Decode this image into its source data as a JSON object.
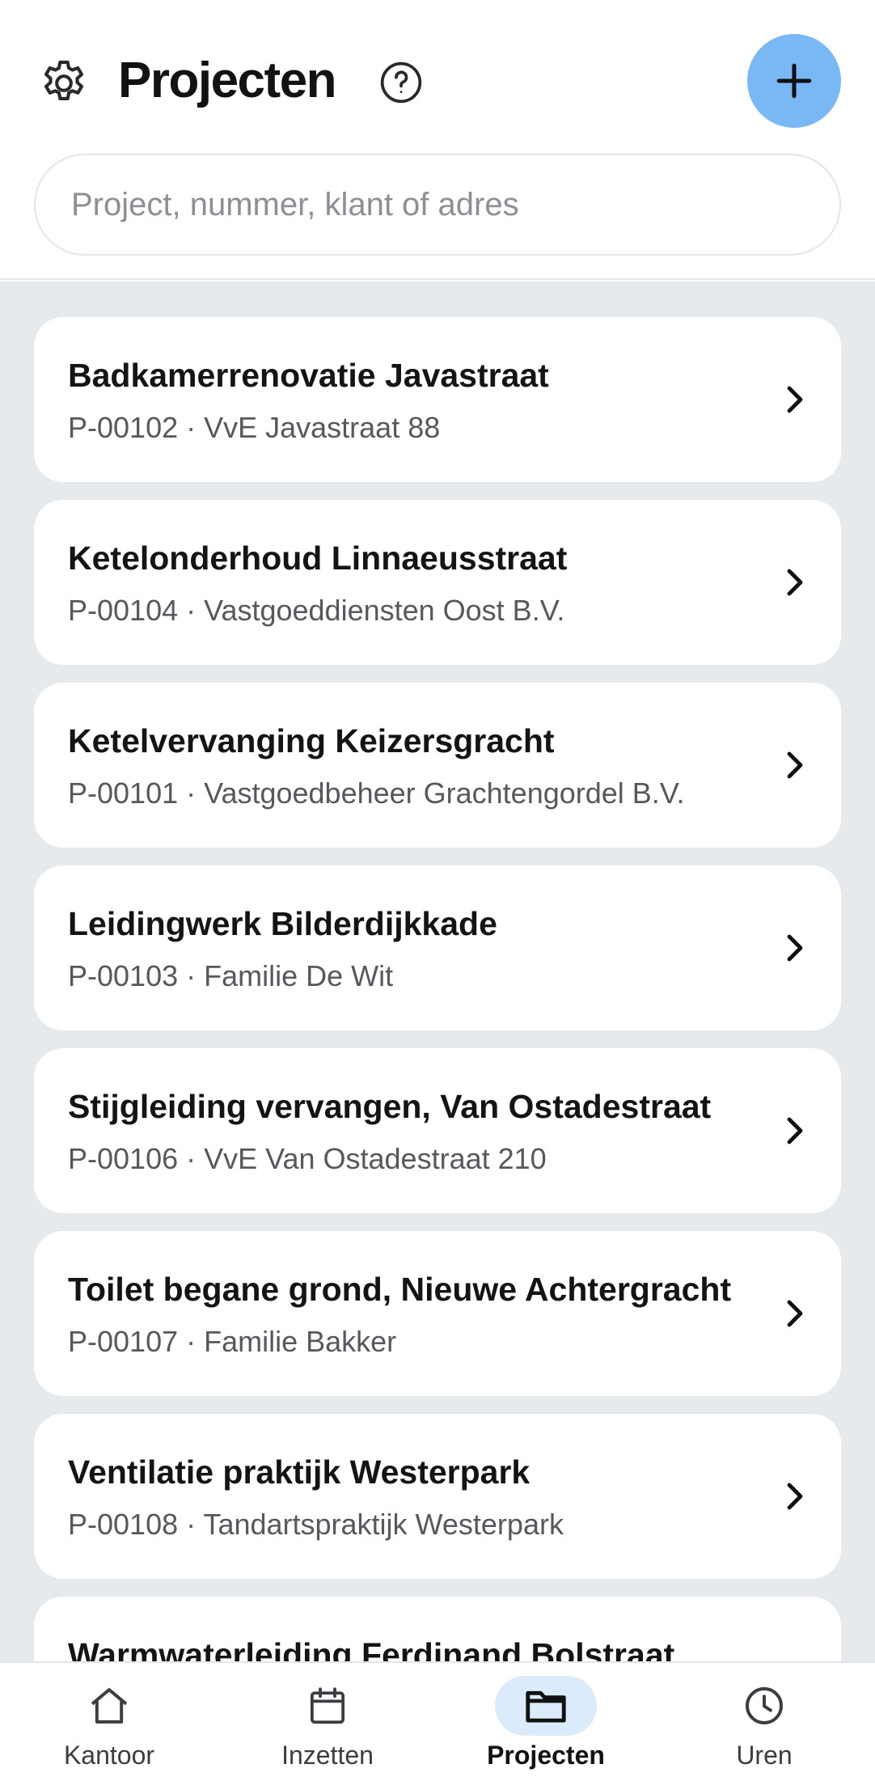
{
  "header": {
    "title": "Projecten",
    "settings_icon": "gear-icon",
    "help_icon": "question-icon",
    "add_icon": "plus-icon",
    "accent_color": "#7ab7f5"
  },
  "search": {
    "placeholder": "Project, nummer, klant of adres",
    "value": ""
  },
  "projects": [
    {
      "title": "Badkamerrenovatie Javastraat",
      "subtitle": "P-00102 · VvE Javastraat 88"
    },
    {
      "title": "Ketelonderhoud Linnaeusstraat",
      "subtitle": "P-00104 · Vastgoeddiensten Oost B.V."
    },
    {
      "title": "Ketelvervanging Keizersgracht",
      "subtitle": "P-00101 · Vastgoedbeheer Grachtengordel B.V."
    },
    {
      "title": "Leidingwerk Bilderdijkkade",
      "subtitle": "P-00103 · Familie De Wit"
    },
    {
      "title": "Stijgleiding vervangen, Van Ostadestraat",
      "subtitle": "P-00106 · VvE Van Ostadestraat 210"
    },
    {
      "title": "Toilet begane grond, Nieuwe Achtergracht",
      "subtitle": "P-00107 · Familie Bakker"
    },
    {
      "title": "Ventilatie praktijk Westerpark",
      "subtitle": "P-00108 · Tandartspraktijk Westerpark"
    },
    {
      "title": "Warmwaterleiding Ferdinand Bolstraat",
      "subtitle": ""
    }
  ],
  "tabbar": {
    "tabs": [
      {
        "label": "Kantoor",
        "icon": "home-icon",
        "active": false
      },
      {
        "label": "Inzetten",
        "icon": "calendar-icon",
        "active": false
      },
      {
        "label": "Projecten",
        "icon": "folder-icon",
        "active": true
      },
      {
        "label": "Uren",
        "icon": "clock-icon",
        "active": false
      }
    ]
  }
}
